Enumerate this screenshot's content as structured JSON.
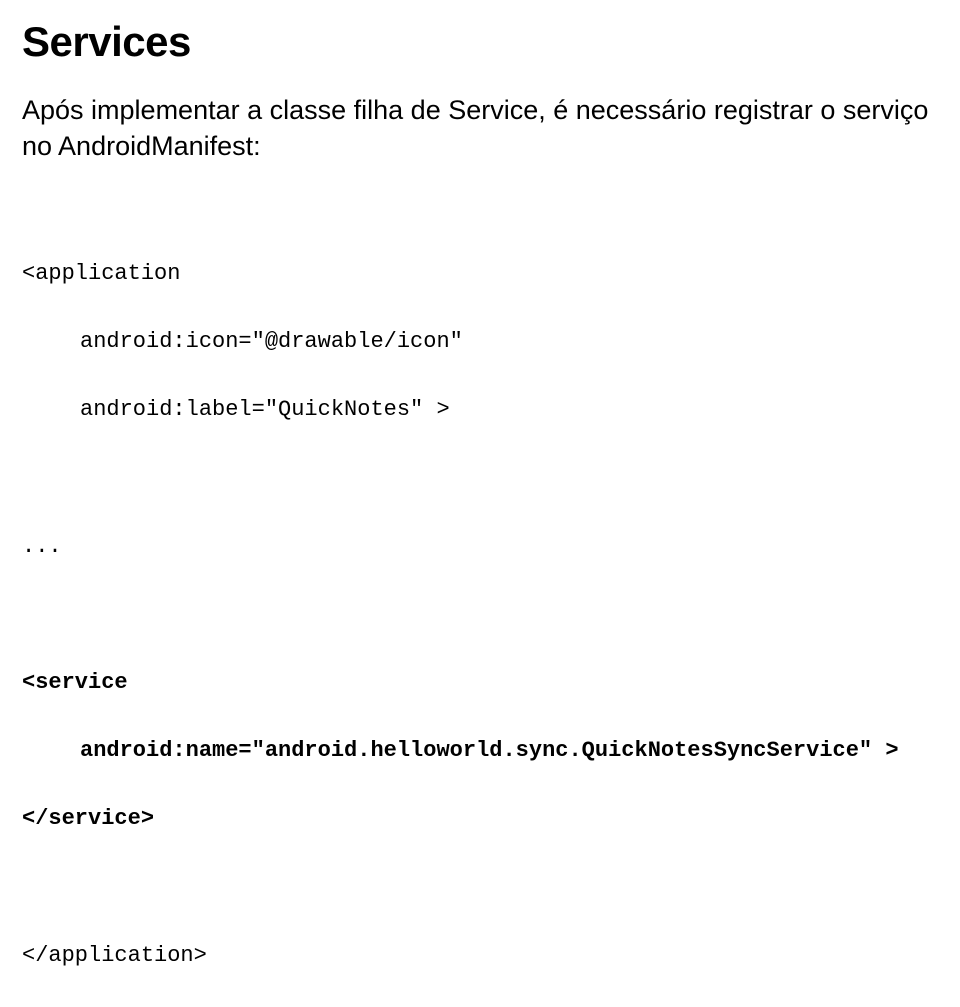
{
  "title": "Services",
  "intro": "Após implementar a classe filha de Service, é necessário registrar o serviço no AndroidManifest:",
  "code": {
    "app_open": "<application",
    "app_icon": "android:icon=\"@drawable/icon\"",
    "app_label": "android:label=\"QuickNotes\" >",
    "ellipsis": "...",
    "svc_open": "<service",
    "svc_name": "android:name=\"android.helloworld.sync.QuickNotesSyncService\" >",
    "svc_close": "</service>",
    "app_close": "</application>"
  }
}
